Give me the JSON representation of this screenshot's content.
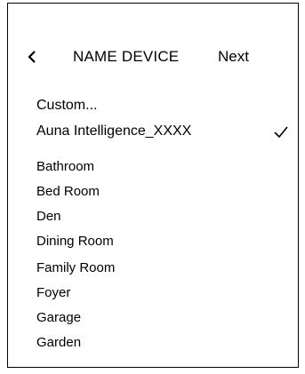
{
  "header": {
    "title": "NAME DEVICE",
    "next_label": "Next",
    "back_icon": "chevron-left-icon"
  },
  "list": {
    "items": [
      {
        "label": "Custom..."
      },
      {
        "label": "Auna Intelligence_XXXX",
        "selected": true
      },
      {
        "label": "Bathroom"
      },
      {
        "label": "Bed Room"
      },
      {
        "label": "Den"
      },
      {
        "label": "Dining Room"
      },
      {
        "label": "Family Room"
      },
      {
        "label": "Foyer"
      },
      {
        "label": "Garage"
      },
      {
        "label": "Garden"
      }
    ],
    "selected_icon": "checkmark-icon"
  }
}
